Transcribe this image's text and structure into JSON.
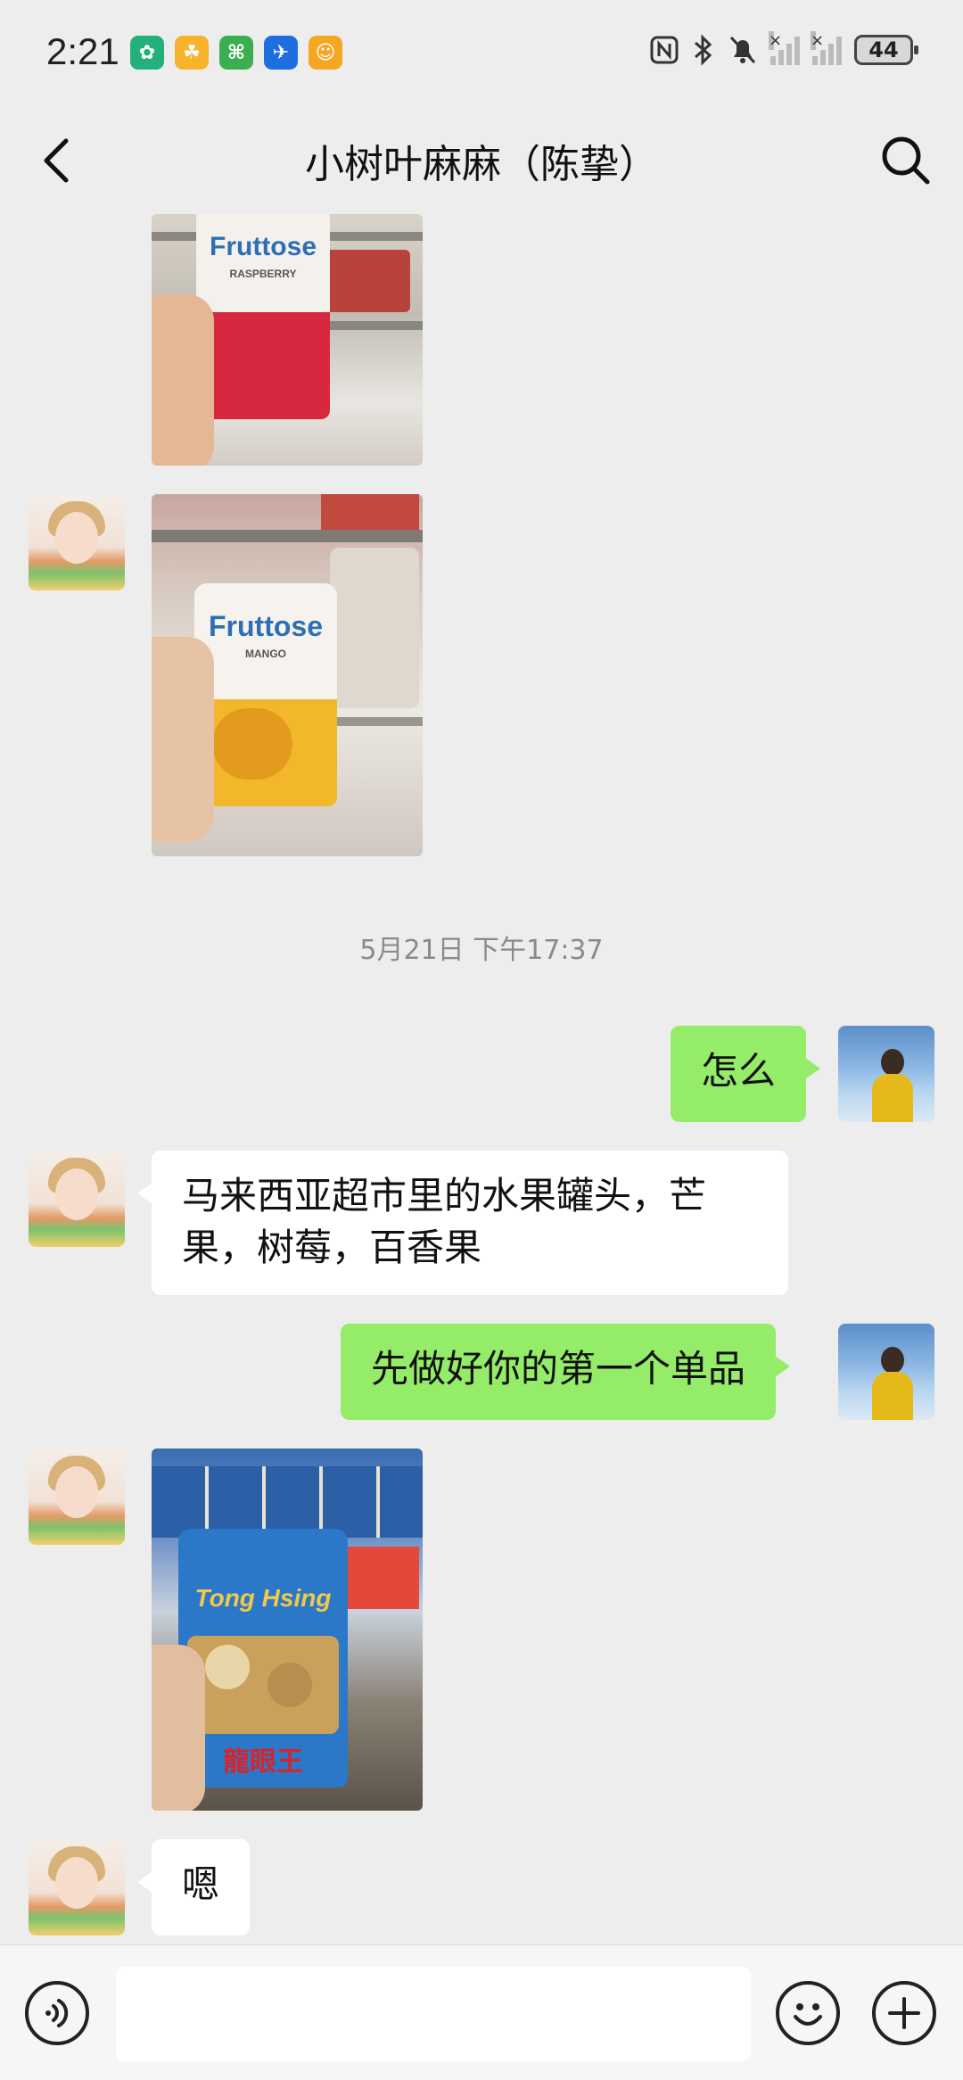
{
  "status_bar": {
    "time": "2:21",
    "battery": "44",
    "app_icons": [
      {
        "name": "app-icon-1",
        "color": "#23b07d",
        "glyph": "✿"
      },
      {
        "name": "app-icon-2",
        "color": "#f7b32b",
        "glyph": "☘"
      },
      {
        "name": "app-icon-3",
        "color": "#3cae4f",
        "glyph": "⌘"
      },
      {
        "name": "app-icon-4",
        "color": "#1d6fe0",
        "glyph": "✈"
      },
      {
        "name": "app-icon-5",
        "color": "#f5a623",
        "glyph": "☺"
      }
    ]
  },
  "header": {
    "title": "小树叶麻麻（陈挚）"
  },
  "photos": [
    {
      "name": "photo-raspberry-can",
      "brand": "Fruttose",
      "label": "RASPBERRY",
      "fruit_color": "#d8283f"
    },
    {
      "name": "photo-mango-can",
      "brand": "Fruttose",
      "label": "MANGO",
      "fruit_color": "#f3b72b"
    },
    {
      "name": "photo-longan-can",
      "brand": "Tong Hsing",
      "label": "龍眼王",
      "fruit_color": "#c9a15a"
    }
  ],
  "timestamp": "5月21日 下午17:37",
  "messages": [
    {
      "from": "me",
      "text": "怎么"
    },
    {
      "from": "her",
      "text": "马来西亚超市里的水果罐头，芒果，树莓，百香果"
    },
    {
      "from": "me",
      "text": "先做好你的第一个单品"
    },
    {
      "from": "her",
      "text": "嗯"
    }
  ],
  "input": {
    "value": "",
    "placeholder": ""
  },
  "colors": {
    "sent_bubble": "#95ec69",
    "received_bubble": "#ffffff",
    "background": "#ededed"
  }
}
